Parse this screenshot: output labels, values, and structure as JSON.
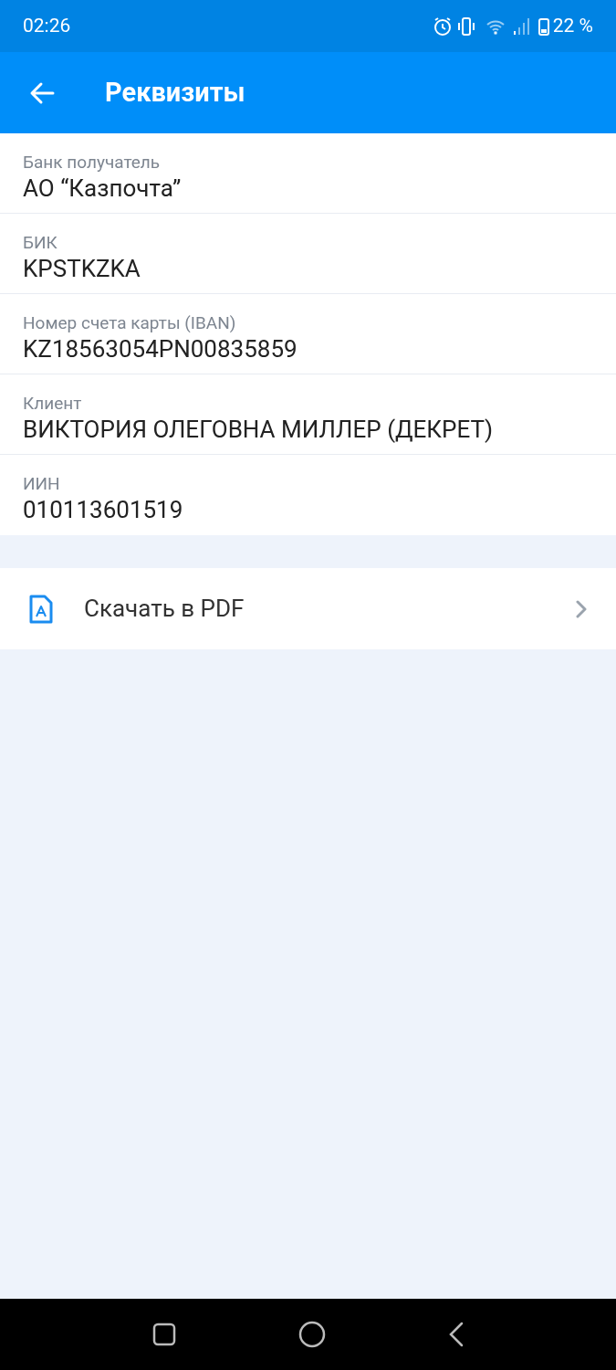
{
  "status_bar": {
    "time": "02:26",
    "battery": "22 %"
  },
  "header": {
    "title": "Реквизиты"
  },
  "fields": [
    {
      "label": "Банк получатель",
      "value": "АО “Казпочта”"
    },
    {
      "label": "БИК",
      "value": "KPSTKZKA"
    },
    {
      "label": "Номер счета карты (IBAN)",
      "value": "KZ18563054PN00835859"
    },
    {
      "label": "Клиент",
      "value": "ВИКТОРИЯ ОЛЕГОВНА МИЛЛЕР (ДЕКРЕТ)"
    },
    {
      "label": "ИИН",
      "value": "010113601519"
    }
  ],
  "download": {
    "label": "Скачать в PDF"
  }
}
